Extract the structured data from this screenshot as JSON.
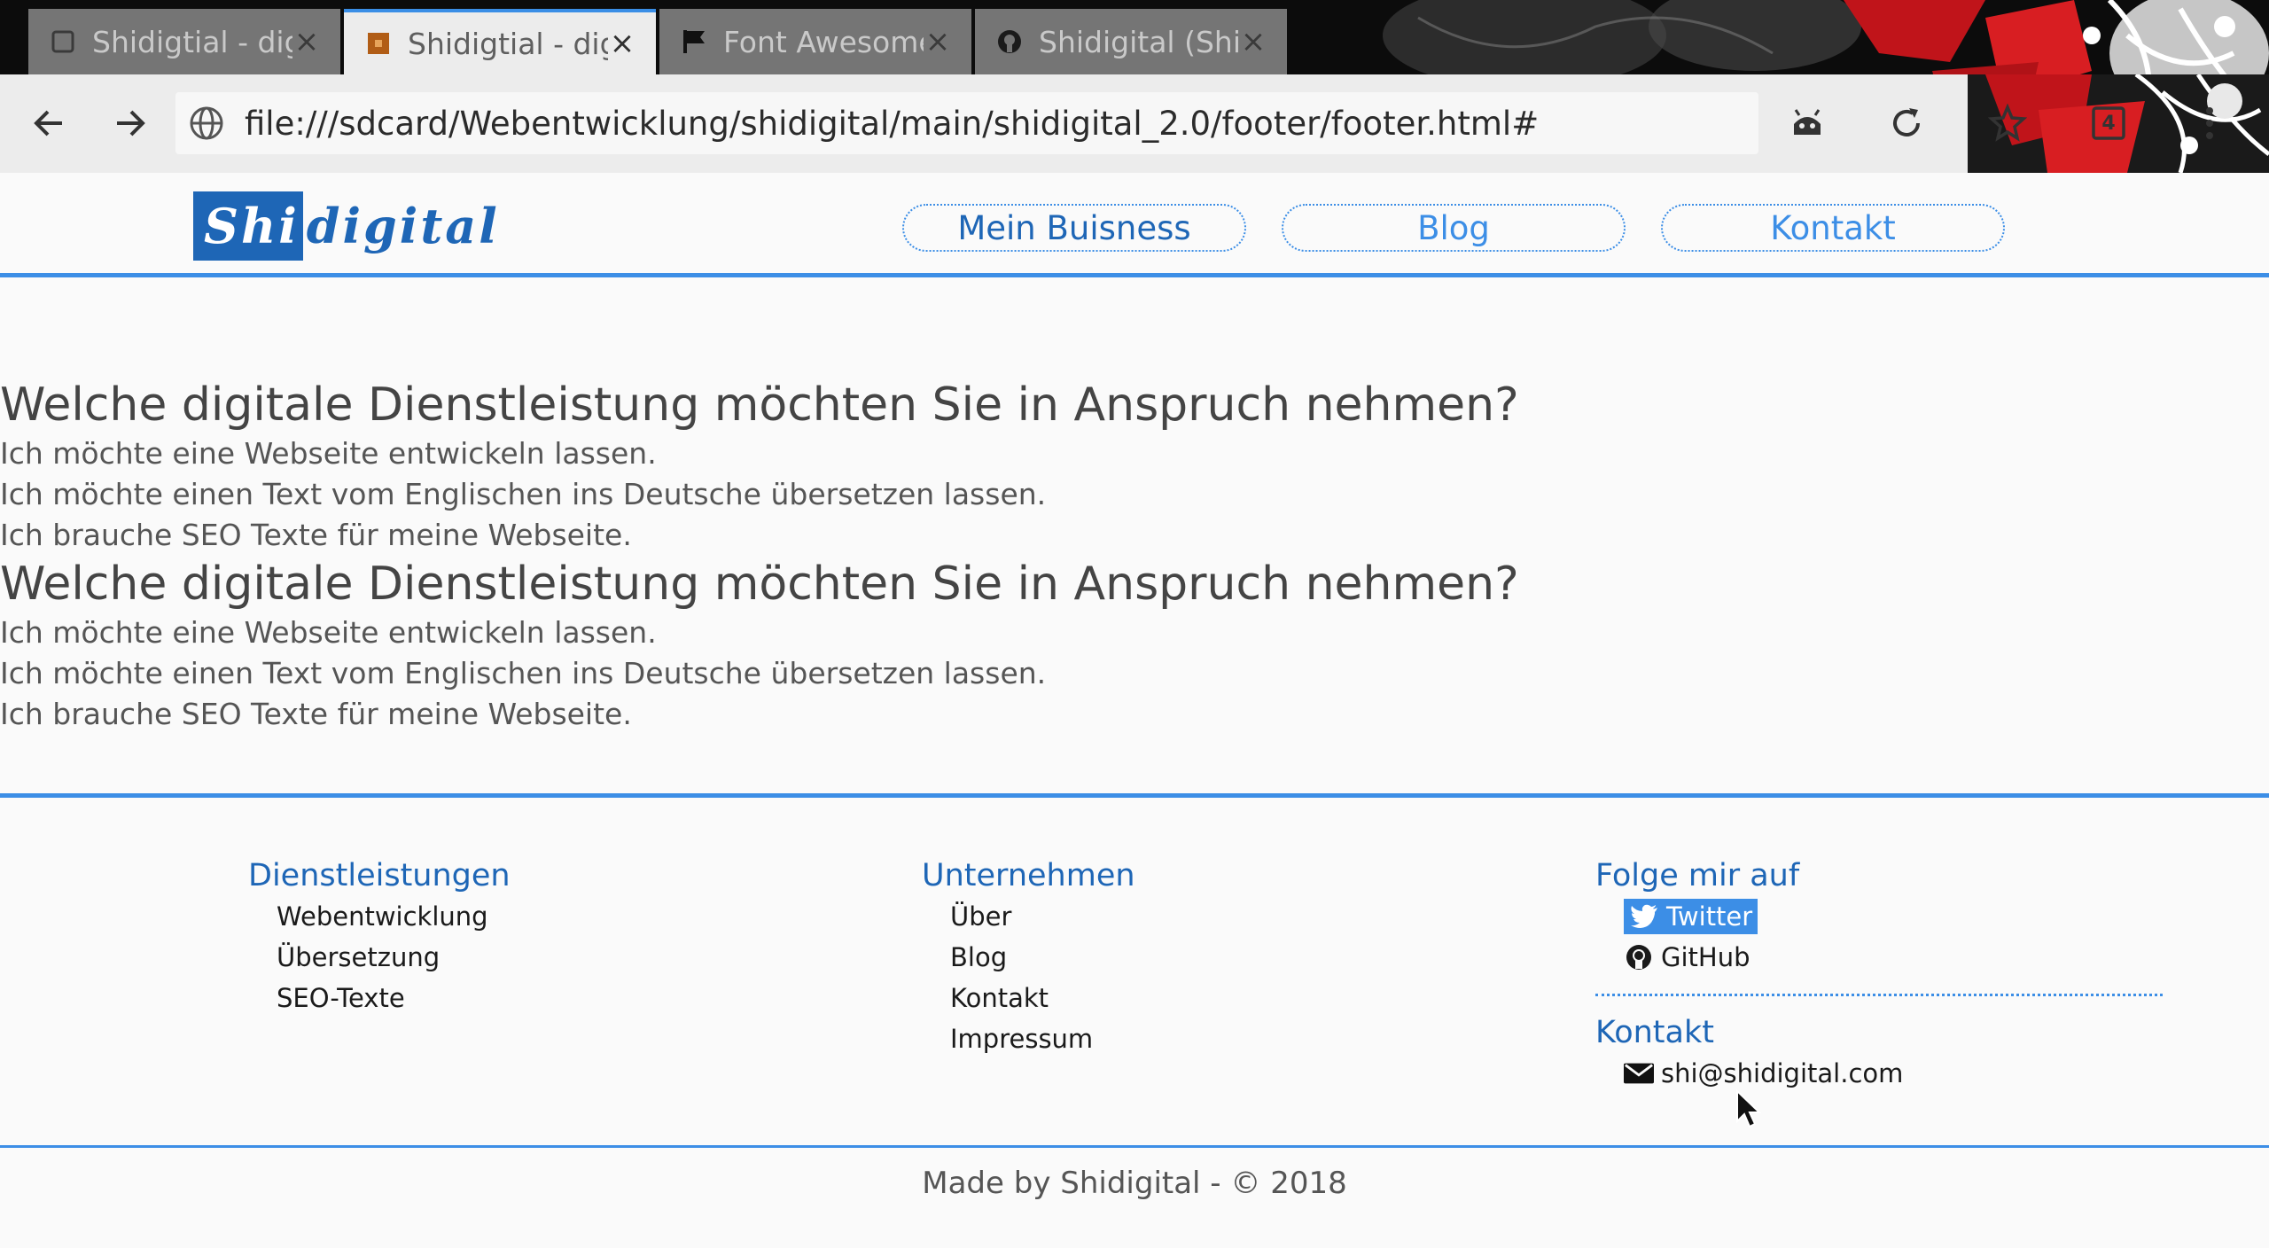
{
  "browser": {
    "tabs": [
      {
        "title": "Shidigtial - digi",
        "icon": "blank-page-icon",
        "active": false
      },
      {
        "title": "Shidigtial - digi",
        "icon": "site-favicon-icon",
        "active": true
      },
      {
        "title": "Font Awesome",
        "icon": "flag-icon",
        "active": false
      },
      {
        "title": "Shidigital (Shi)",
        "icon": "github-icon",
        "active": false
      }
    ],
    "close_glyph": "×",
    "url": "file:///sdcard/Webentwicklung/shidigital/main/shidigital_2.0/footer/footer.html#",
    "tab_count": "4",
    "accent": "#3a8ee6"
  },
  "site": {
    "logo": {
      "box_text": "Shi",
      "rest_text": "digital"
    },
    "nav": [
      "Mein Buisness",
      "Blog",
      "Kontakt"
    ],
    "sections": [
      {
        "heading": "Welche digitale Dienstleistung möchten Sie in Anspruch nehmen?",
        "lines": [
          "Ich möchte eine Webseite entwickeln lassen.",
          "Ich möchte einen Text vom Englischen ins Deutsche übersetzen lassen.",
          "Ich brauche SEO Texte für meine Webseite."
        ]
      },
      {
        "heading": "Welche digitale Dienstleistung möchten Sie in Anspruch nehmen?",
        "lines": [
          "Ich möchte eine Webseite entwickeln lassen.",
          "Ich möchte einen Text vom Englischen ins Deutsche übersetzen lassen.",
          "Ich brauche SEO Texte für meine Webseite."
        ]
      }
    ],
    "footer": {
      "services": {
        "title": "Dienstleistungen",
        "items": [
          "Webentwicklung",
          "Übersetzung",
          "SEO-Texte"
        ]
      },
      "company": {
        "title": "Unternehmen",
        "items": [
          "Über",
          "Blog",
          "Kontakt",
          "Impressum"
        ]
      },
      "follow": {
        "title": "Folge mir auf",
        "twitter": "Twitter",
        "github": "GitHub"
      },
      "contact": {
        "title": "Kontakt",
        "email": "shi@shidigital.com"
      },
      "copyright": "Made by Shidigital - © 2018"
    },
    "colors": {
      "primary": "#1e66b6",
      "accent": "#3c8ee6",
      "text": "#444444"
    }
  }
}
